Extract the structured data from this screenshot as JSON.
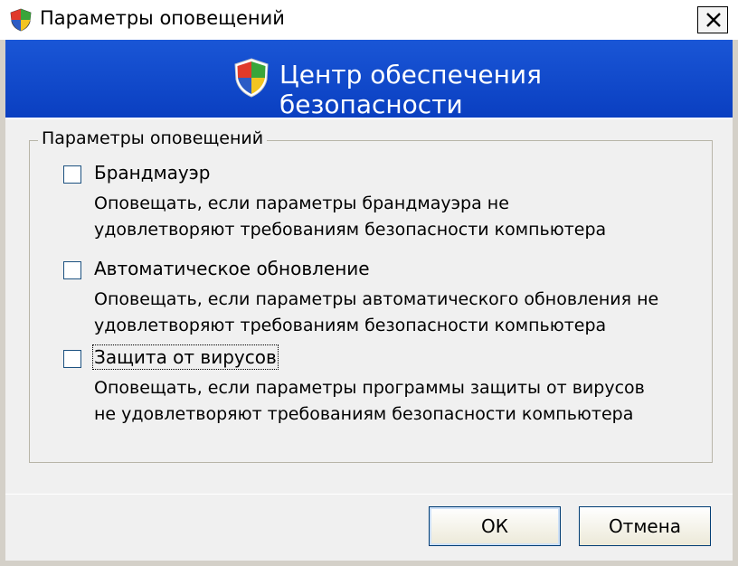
{
  "window": {
    "title": "Параметры оповещений",
    "icon": "security-shield-icon"
  },
  "banner": {
    "title": "Центр обеспечения безопасности",
    "icon": "security-shield-icon"
  },
  "group": {
    "legend": "Параметры оповещений",
    "options": [
      {
        "label": "Брандмауэр",
        "checked": false,
        "desc_line1": "Оповещать, если параметры брандмауэра не",
        "desc_line2": "удовлетворяют требованиям безопасности компьютера"
      },
      {
        "label": "Автоматическое обновление",
        "checked": false,
        "desc_line1": "Оповещать, если параметры автоматического обновления не",
        "desc_line2": "удовлетворяют требованиям безопасности компьютера"
      },
      {
        "label": "Защита от вирусов",
        "checked": false,
        "focused": true,
        "desc_line1": "Оповещать, если параметры программы защиты от вирусов",
        "desc_line2": "не удовлетворяют требованиям безопасности компьютера"
      }
    ]
  },
  "buttons": {
    "ok": "ОК",
    "cancel": "Отмена"
  },
  "colors": {
    "banner": "#0a3fc1",
    "dialog_face": "#ece9d8"
  }
}
